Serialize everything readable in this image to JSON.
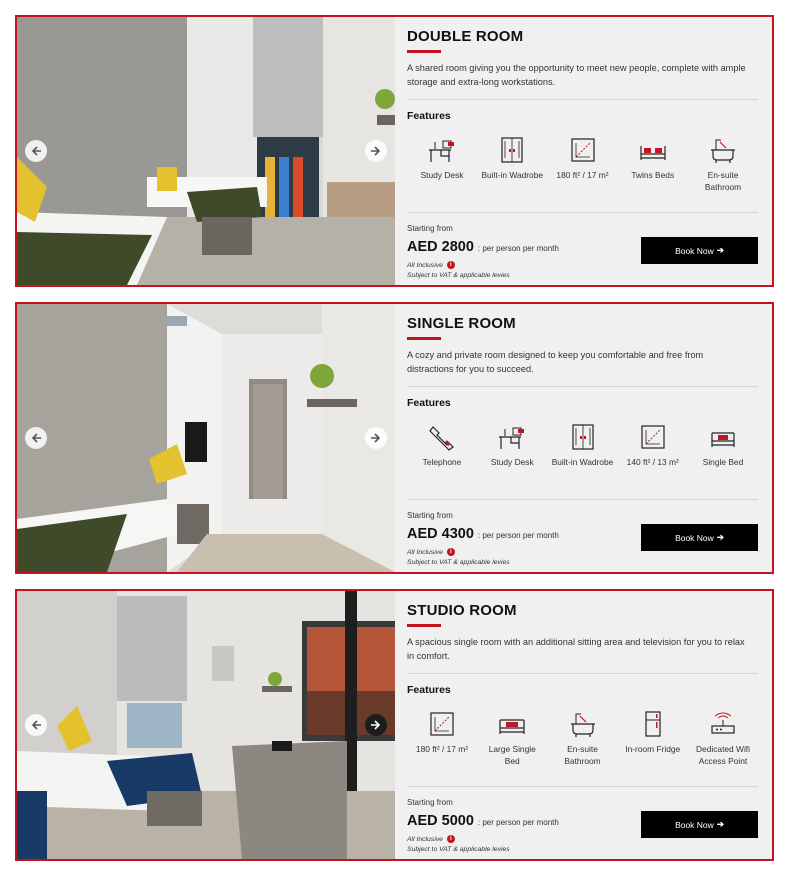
{
  "colors": {
    "accent": "#c41420",
    "card_bg": "#f1f0f0",
    "button_bg": "#000000"
  },
  "rooms": [
    {
      "title": "DOUBLE ROOM",
      "description": "A shared room giving you the opportunity to meet new people, complete with ample storage and extra-long workstations.",
      "features_heading": "Features",
      "features": [
        {
          "icon": "study-desk-icon",
          "label": "Study Desk"
        },
        {
          "icon": "wardrobe-icon",
          "label": "Built-in Wadrobe"
        },
        {
          "icon": "area-icon",
          "label": "180 ft² / 17 m²"
        },
        {
          "icon": "twin-beds-icon",
          "label": "Twins Beds"
        },
        {
          "icon": "bathroom-icon",
          "label": "En-suite Bathroom"
        }
      ],
      "starting_from": "Starting from",
      "price": "AED 2800",
      "per": ": per person per month",
      "inclusive": "All Inclusive",
      "vat": "Subject to VAT & applicable levies",
      "book_label": "Book Now"
    },
    {
      "title": "SINGLE ROOM",
      "description": "A cozy and private room designed to keep you comfortable and free from distractions for you to succeed.",
      "features_heading": "Features",
      "features": [
        {
          "icon": "telephone-icon",
          "label": "Telephone"
        },
        {
          "icon": "study-desk-icon",
          "label": "Study Desk"
        },
        {
          "icon": "wardrobe-icon",
          "label": "Built-in Wadrobe"
        },
        {
          "icon": "area-icon",
          "label": "140 ft² / 13 m²"
        },
        {
          "icon": "single-bed-icon",
          "label": "Single Bed"
        }
      ],
      "starting_from": "Starting from",
      "price": "AED 4300",
      "per": ": per person per month",
      "inclusive": "All Inclusive",
      "vat": "Subject to VAT & applicable levies",
      "book_label": "Book Now"
    },
    {
      "title": "STUDIO ROOM",
      "description": "A spacious single room with an additional sitting area and television for you to relax in comfort.",
      "features_heading": "Features",
      "features": [
        {
          "icon": "area-icon",
          "label": "180 ft² / 17 m²"
        },
        {
          "icon": "large-single-bed-icon",
          "label": "Large Single Bed"
        },
        {
          "icon": "bathroom-icon",
          "label": "En-suite Bathroom"
        },
        {
          "icon": "fridge-icon",
          "label": "In-room Fridge"
        },
        {
          "icon": "wifi-router-icon",
          "label": "Dedicated Wifi Access Point"
        }
      ],
      "starting_from": "Starting from",
      "price": "AED 5000",
      "per": ": per person per month",
      "inclusive": "All Inclusive",
      "vat": "Subject to VAT & applicable levies",
      "book_label": "Book Now"
    }
  ]
}
